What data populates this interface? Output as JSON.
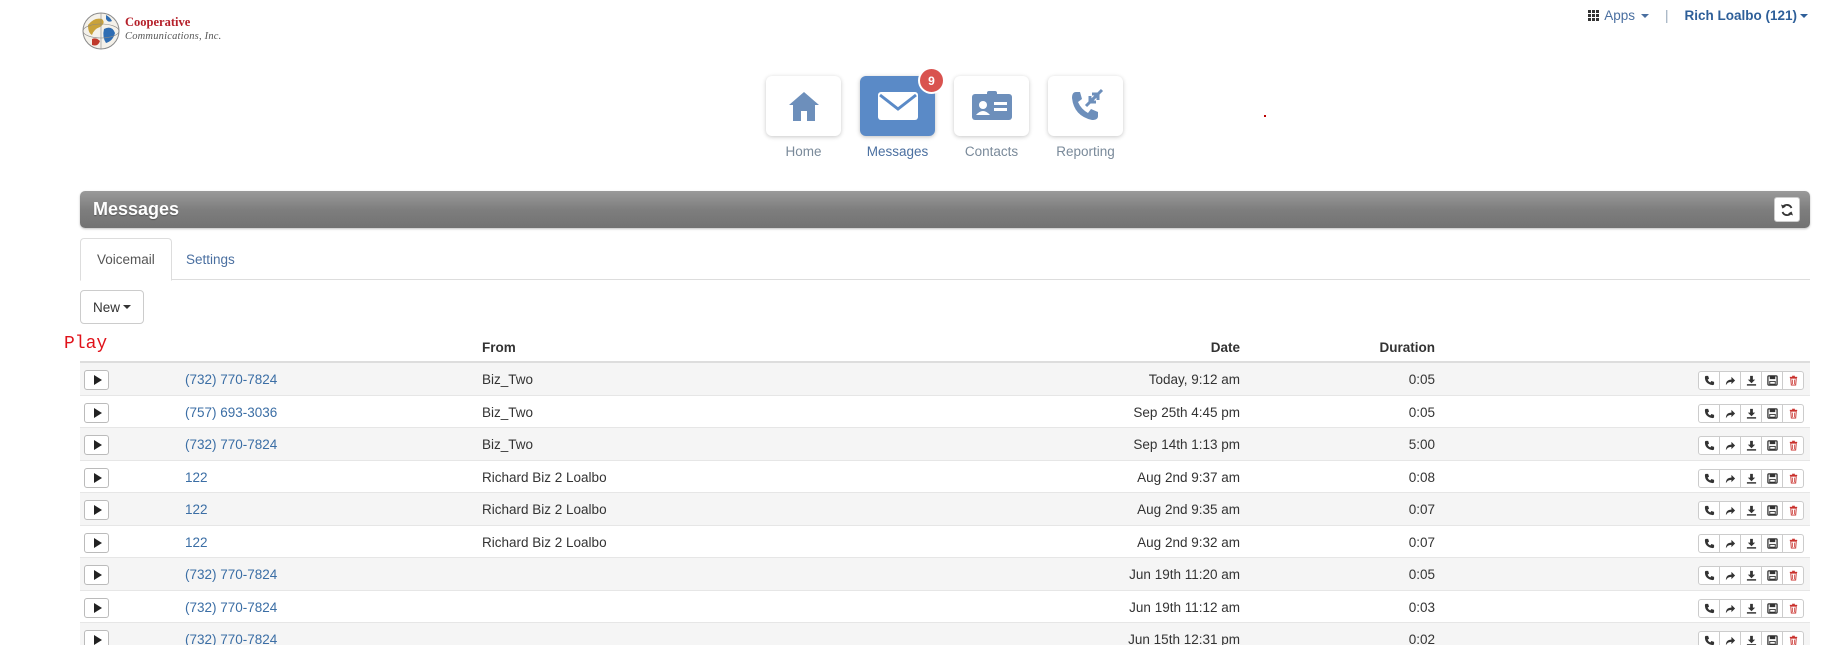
{
  "logo": {
    "line1": "Cooperative",
    "line2": "Communications, Inc."
  },
  "topbar": {
    "apps_label": "Apps",
    "user_label": "Rich Loalbo (121)"
  },
  "nav": {
    "home": "Home",
    "messages": "Messages",
    "messages_badge": "9",
    "contacts": "Contacts",
    "reporting": "Reporting"
  },
  "panel": {
    "title": "Messages"
  },
  "tabs": {
    "voicemail": "Voicemail",
    "settings": "Settings"
  },
  "new_button": "New",
  "play_header": "Play",
  "table": {
    "headers": {
      "from": "From",
      "date": "Date",
      "duration": "Duration"
    },
    "rows": [
      {
        "number": "(732) 770-7824",
        "from": "Biz_Two",
        "date": "Today, 9:12 am",
        "duration": "0:05"
      },
      {
        "number": "(757) 693-3036",
        "from": "Biz_Two",
        "date": "Sep 25th 4:45 pm",
        "duration": "0:05"
      },
      {
        "number": "(732) 770-7824",
        "from": "Biz_Two",
        "date": "Sep 14th 1:13 pm",
        "duration": "5:00"
      },
      {
        "number": "122",
        "from": "Richard Biz 2 Loalbo",
        "date": "Aug 2nd 9:37 am",
        "duration": "0:08"
      },
      {
        "number": "122",
        "from": "Richard Biz 2 Loalbo",
        "date": "Aug 2nd 9:35 am",
        "duration": "0:07"
      },
      {
        "number": "122",
        "from": "Richard Biz 2 Loalbo",
        "date": "Aug 2nd 9:32 am",
        "duration": "0:07"
      },
      {
        "number": "(732) 770-7824",
        "from": "",
        "date": "Jun 19th 11:20 am",
        "duration": "0:05"
      },
      {
        "number": "(732) 770-7824",
        "from": "",
        "date": "Jun 19th 11:12 am",
        "duration": "0:03"
      },
      {
        "number": "(732) 770-7824",
        "from": "",
        "date": "Jun 15th 12:31 pm",
        "duration": "0:02"
      }
    ],
    "row_actions": [
      "call-icon",
      "forward-icon",
      "download-icon",
      "save-icon",
      "trash-icon"
    ]
  },
  "colors": {
    "link": "#3b6ea5",
    "active_tile": "#5a8ac7",
    "badge": "#d9534f",
    "brand_red": "#b5202a"
  }
}
